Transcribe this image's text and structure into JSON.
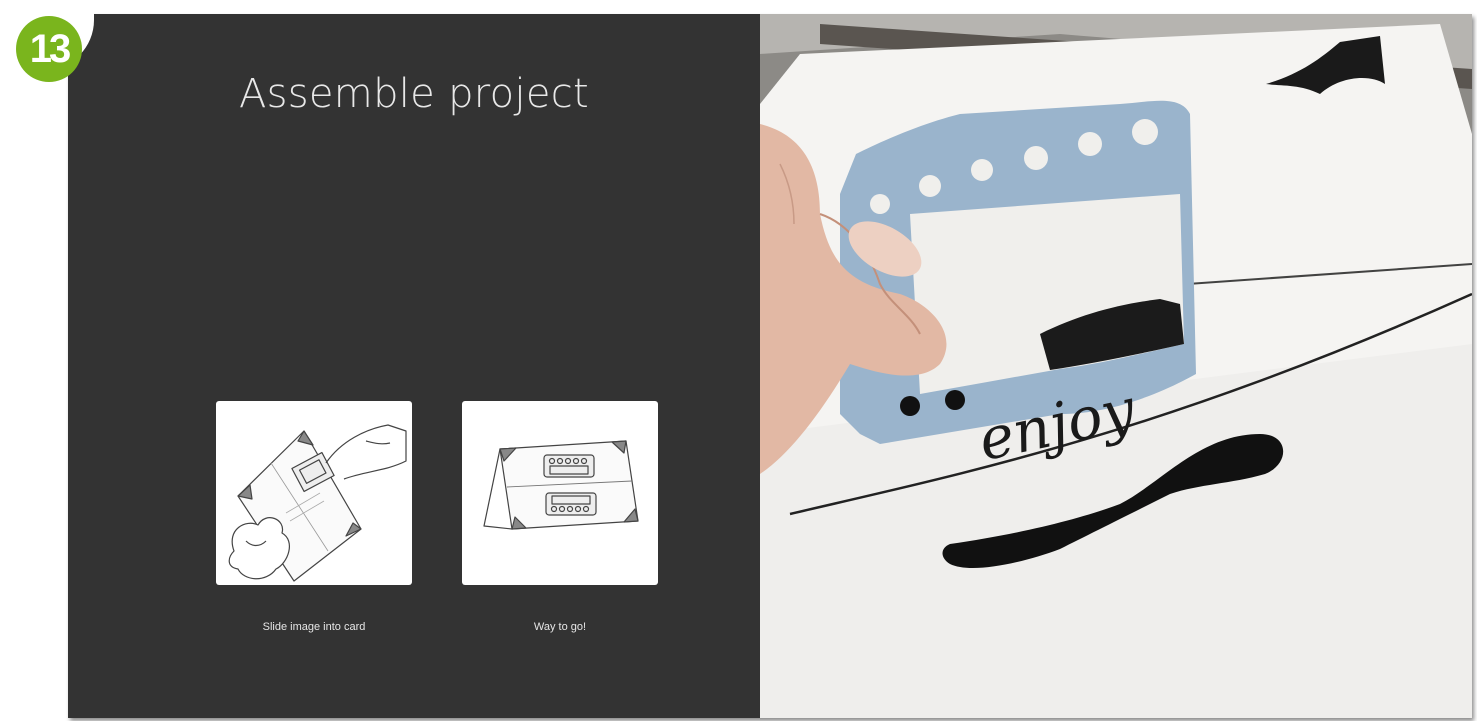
{
  "step": {
    "number": "13"
  },
  "panel": {
    "title": "Assemble project"
  },
  "cards": [
    {
      "caption": "Slide image into card",
      "illustration": "slide-image-illustration"
    },
    {
      "caption": "Way to go!",
      "illustration": "finished-card-illustration"
    }
  ],
  "photo": {
    "card_text": "enjoy"
  },
  "colors": {
    "badge": "#7ab51d",
    "panel": "#333333",
    "accent_paper": "#9ab4cc"
  }
}
